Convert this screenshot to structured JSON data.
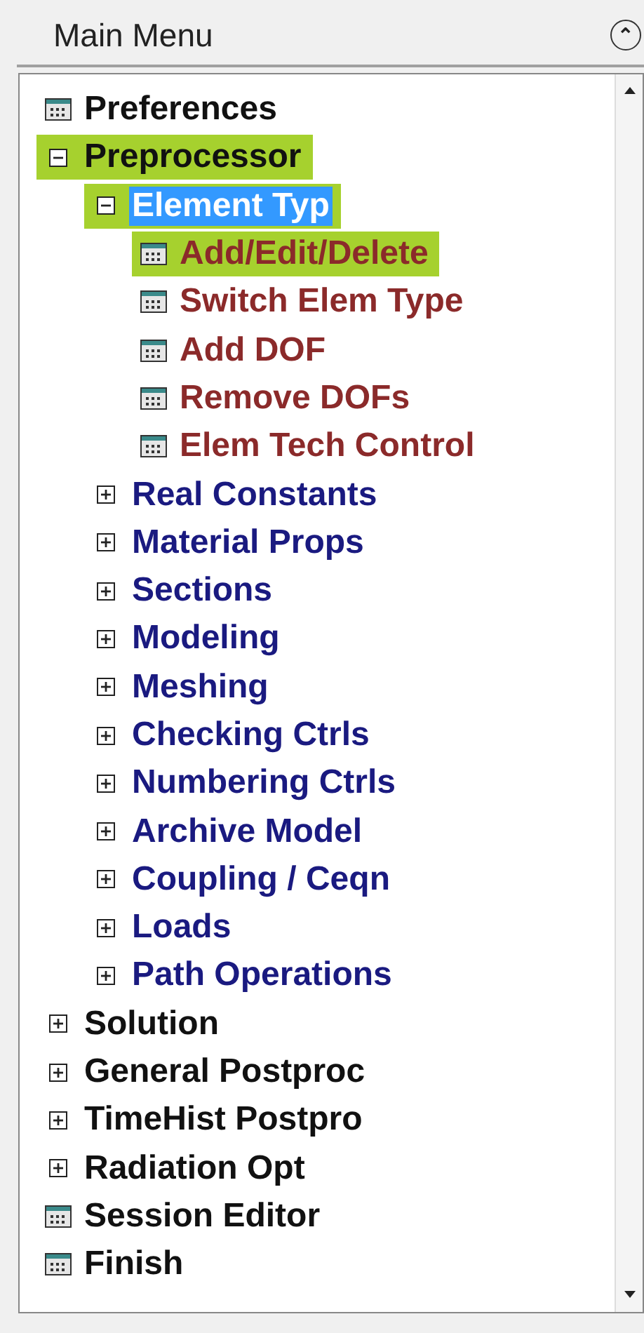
{
  "header": {
    "title": "Main Menu",
    "collapse_glyph": "⌃"
  },
  "tree": [
    {
      "label": "Preferences",
      "kind": "dialog",
      "highlighted": false,
      "selected": false
    },
    {
      "label": "Preprocessor",
      "kind": "folder",
      "expanded": true,
      "highlighted": true,
      "selected": false,
      "children": [
        {
          "label": "Element Typ",
          "kind": "folder",
          "expanded": true,
          "highlighted": true,
          "selected": true,
          "children": [
            {
              "label": "Add/Edit/Delete",
              "kind": "dialog",
              "highlighted": true,
              "selected": false
            },
            {
              "label": "Switch Elem Type",
              "kind": "dialog",
              "highlighted": false,
              "selected": false
            },
            {
              "label": "Add DOF",
              "kind": "dialog",
              "highlighted": false,
              "selected": false
            },
            {
              "label": "Remove DOFs",
              "kind": "dialog",
              "highlighted": false,
              "selected": false
            },
            {
              "label": "Elem Tech Control",
              "kind": "dialog",
              "highlighted": false,
              "selected": false
            }
          ]
        },
        {
          "label": "Real Constants",
          "kind": "folder",
          "expanded": false,
          "highlighted": false,
          "selected": false
        },
        {
          "label": "Material Props",
          "kind": "folder",
          "expanded": false,
          "highlighted": false,
          "selected": false
        },
        {
          "label": "Sections",
          "kind": "folder",
          "expanded": false,
          "highlighted": false,
          "selected": false
        },
        {
          "label": "Modeling",
          "kind": "folder",
          "expanded": false,
          "highlighted": false,
          "selected": false
        },
        {
          "label": "Meshing",
          "kind": "folder",
          "expanded": false,
          "highlighted": false,
          "selected": false
        },
        {
          "label": "Checking Ctrls",
          "kind": "folder",
          "expanded": false,
          "highlighted": false,
          "selected": false
        },
        {
          "label": "Numbering Ctrls",
          "kind": "folder",
          "expanded": false,
          "highlighted": false,
          "selected": false
        },
        {
          "label": "Archive Model",
          "kind": "folder",
          "expanded": false,
          "highlighted": false,
          "selected": false
        },
        {
          "label": "Coupling / Ceqn",
          "kind": "folder",
          "expanded": false,
          "highlighted": false,
          "selected": false
        },
        {
          "label": "Loads",
          "kind": "folder",
          "expanded": false,
          "highlighted": false,
          "selected": false
        },
        {
          "label": "Path Operations",
          "kind": "folder",
          "expanded": false,
          "highlighted": false,
          "selected": false
        }
      ]
    },
    {
      "label": "Solution",
      "kind": "folder",
      "expanded": false,
      "highlighted": false,
      "selected": false
    },
    {
      "label": "General Postproc",
      "kind": "folder",
      "expanded": false,
      "highlighted": false,
      "selected": false
    },
    {
      "label": "TimeHist Postpro",
      "kind": "folder",
      "expanded": false,
      "highlighted": false,
      "selected": false
    },
    {
      "label": "Radiation Opt",
      "kind": "folder",
      "expanded": false,
      "highlighted": false,
      "selected": false
    },
    {
      "label": "Session Editor",
      "kind": "dialog",
      "highlighted": false,
      "selected": false
    },
    {
      "label": "Finish",
      "kind": "dialog",
      "highlighted": false,
      "selected": false
    }
  ]
}
